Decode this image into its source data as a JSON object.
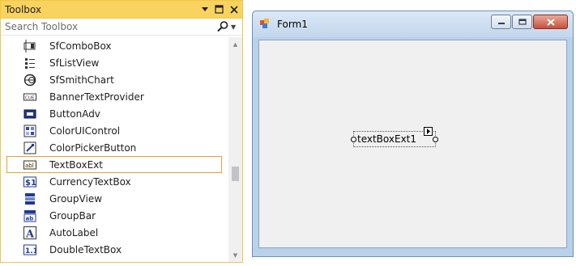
{
  "toolbox": {
    "title": "Toolbox",
    "search_placeholder": "Search Toolbox",
    "items": [
      {
        "label": "SfComboBox",
        "icon": "combobox-icon"
      },
      {
        "label": "SfListView",
        "icon": "listview-icon"
      },
      {
        "label": "SfSmithChart",
        "icon": "smithchart-icon"
      },
      {
        "label": "BannerTextProvider",
        "icon": "banner-icon"
      },
      {
        "label": "ButtonAdv",
        "icon": "button-icon"
      },
      {
        "label": "ColorUIControl",
        "icon": "color-ui-icon"
      },
      {
        "label": "ColorPickerButton",
        "icon": "color-picker-icon"
      },
      {
        "label": "TextBoxExt",
        "icon": "textbox-icon",
        "selected": true
      },
      {
        "label": "CurrencyTextBox",
        "icon": "currency-icon"
      },
      {
        "label": "GroupView",
        "icon": "groupview-icon"
      },
      {
        "label": "GroupBar",
        "icon": "groupbar-icon"
      },
      {
        "label": "AutoLabel",
        "icon": "autolabel-icon"
      },
      {
        "label": "DoubleTextBox",
        "icon": "double-textbox-icon"
      }
    ]
  },
  "form": {
    "title": "Form1",
    "textbox_text": "textBoxExt1"
  },
  "colors": {
    "toolbox_header": "#f9d35f",
    "selection_border": "#e8a13b",
    "form_frame": "#b9d1ea",
    "form_client": "#f0f0f0"
  }
}
